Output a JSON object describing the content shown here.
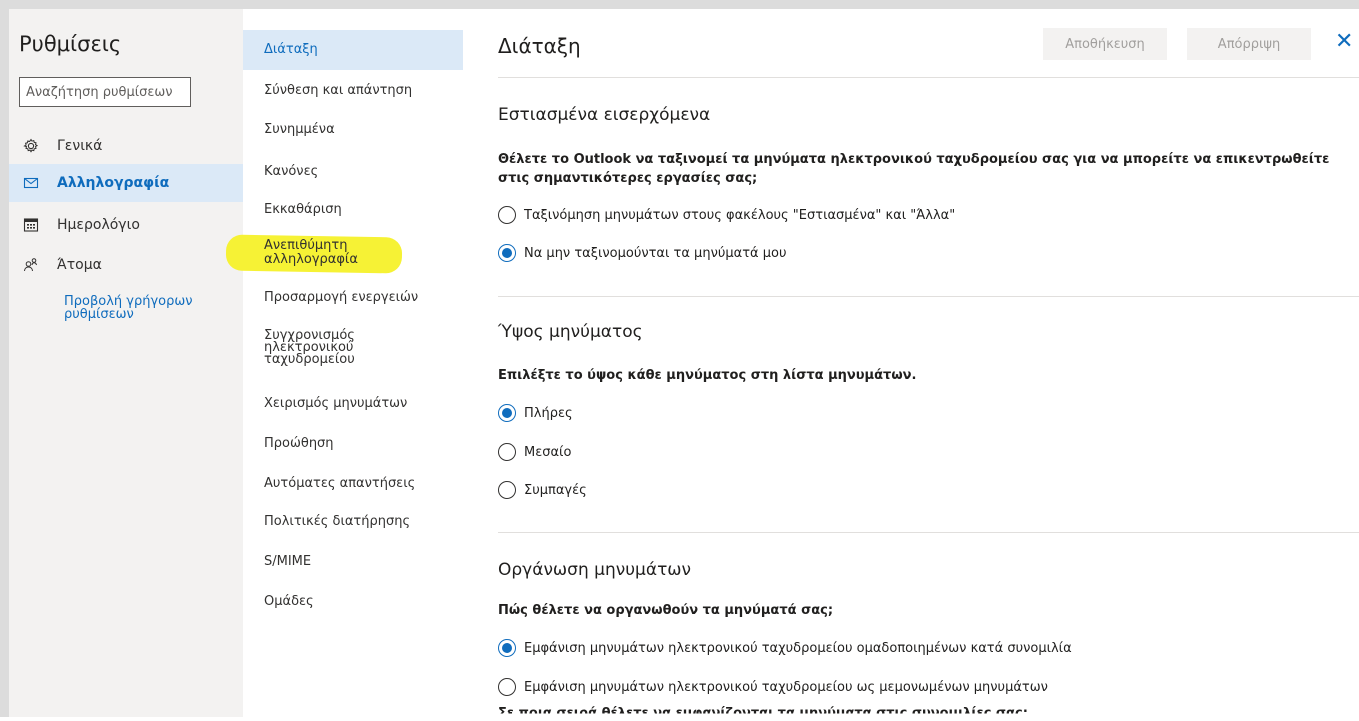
{
  "left_pane": {
    "title": "Ρυθμίσεις",
    "search_placeholder": "Αναζήτηση ρυθμίσεων",
    "nav": [
      {
        "label": "Γενικά",
        "icon": "gear-icon",
        "active": false
      },
      {
        "label": "Αλληλογραφία",
        "icon": "mail-icon",
        "active": true
      },
      {
        "label": "Ημερολόγιο",
        "icon": "calendar-icon",
        "active": false
      },
      {
        "label": "Άτομα",
        "icon": "people-icon",
        "active": false
      }
    ],
    "quick_settings_link": "Προβολή γρήγορων ρυθμίσεων"
  },
  "mail_subnav": {
    "items": [
      "Διάταξη",
      "Σύνθεση και απάντηση",
      "Συνημμένα",
      "Κανόνες",
      "Εκκαθάριση",
      "Ανεπιθύμητη αλληλογραφία",
      "Προσαρμογή ενεργειών",
      "Συγχρονισμός ηλεκτρονικού ταχυδρομείου",
      "Χειρισμός μηνυμάτων",
      "Προώθηση",
      "Αυτόματες απαντήσεις",
      "Πολιτικές διατήρησης",
      "S/MIME",
      "Ομάδες"
    ],
    "active_index": 0,
    "highlight_color": "#f6f12a"
  },
  "main": {
    "title": "Διάταξη",
    "save_label": "Αποθήκευση",
    "discard_label": "Απόρριψη",
    "close_icon": "close-icon",
    "sections": [
      {
        "title": "Εστιασμένα εισερχόμενα",
        "question": "Θέλετε το Outlook να ταξινομεί τα μηνύματα ηλεκτρονικού ταχυδρομείου σας για να μπορείτε να επικεντρωθείτε στις σημαντικότερες εργασίες σας;",
        "options": [
          {
            "label": "Ταξινόμηση μηνυμάτων στους φακέλους \"Εστιασμένα\" και \"Άλλα\"",
            "checked": false
          },
          {
            "label": "Να μην ταξινομούνται τα μηνύματά μου",
            "checked": true
          }
        ]
      },
      {
        "title": "Ύψος μηνύματος",
        "question": "Επιλέξτε το ύψος κάθε μηνύματος στη λίστα μηνυμάτων.",
        "options": [
          {
            "label": "Πλήρες",
            "checked": true
          },
          {
            "label": "Μεσαίο",
            "checked": false
          },
          {
            "label": "Συμπαγές",
            "checked": false
          }
        ]
      },
      {
        "title": "Οργάνωση μηνυμάτων",
        "question": "Πώς θέλετε να οργανωθούν τα μηνύματά σας;",
        "options": [
          {
            "label": "Εμφάνιση μηνυμάτων ηλεκτρονικού ταχυδρομείου ομαδοποιημένων κατά συνομιλία",
            "checked": true
          },
          {
            "label": "Εμφάνιση μηνυμάτων ηλεκτρονικού ταχυδρομείου ως μεμονωμένων μηνυμάτων",
            "checked": false
          }
        ]
      }
    ],
    "cutoff_text": "Σε ποια σειρά θέλετε να εμφανίζονται τα μηνύματα στις συνομιλίες σας;"
  },
  "colors": {
    "accent": "#0f6cbd",
    "active_bg": "#dbe9f7",
    "pane_bg": "#f3f2f1"
  }
}
